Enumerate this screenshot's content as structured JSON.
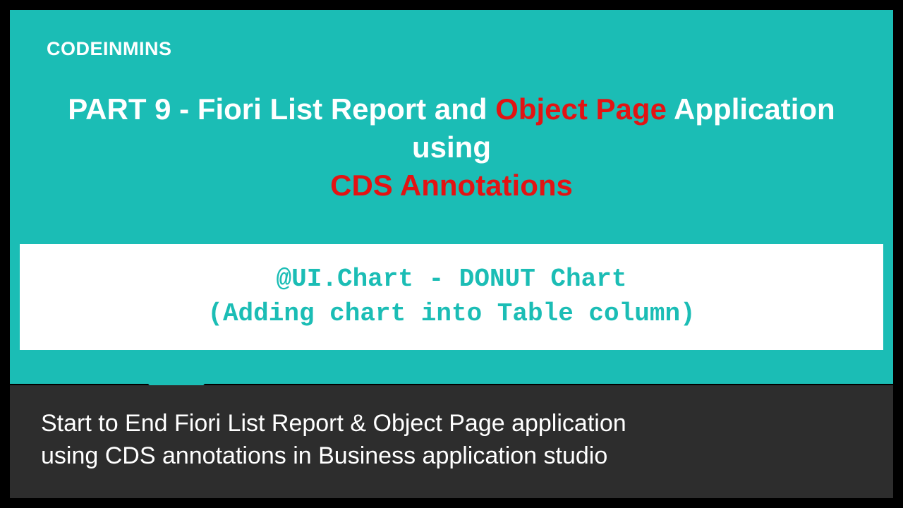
{
  "brand": "CODEINMINS",
  "title": {
    "line1_a": "PART 9 - Fiori List Report and ",
    "line1_hl": "Object Page",
    "line1_b": " Application",
    "line2": "using",
    "line3_hl": "CDS Annotations"
  },
  "subtitle": {
    "line1": "@UI.Chart - DONUT Chart",
    "line2": "(Adding chart into Table column)"
  },
  "footer": {
    "line1": "Start to End Fiori List Report & Object Page application",
    "line2": "using CDS annotations in Business application studio"
  },
  "colors": {
    "teal": "#1bbdb5",
    "accent_red": "#e31313",
    "footer_bg": "#2d2d2d"
  }
}
